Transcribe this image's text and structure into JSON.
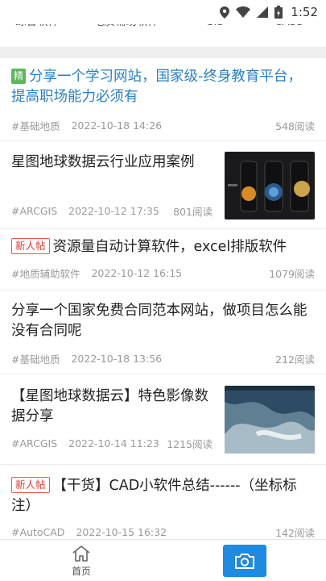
{
  "status_bar": {
    "time": "1:52",
    "icons": [
      "location-icon",
      "wifi-icon",
      "signal-icon",
      "battery-icon"
    ]
  },
  "tabs": [
    {
      "label": "综合软件"
    },
    {
      "label": "地质辅助软件"
    },
    {
      "label": "GIS"
    },
    {
      "label": "CASS"
    }
  ],
  "feed": [
    {
      "badge": "精",
      "title": "分享一个学习网站，国家级-终身教育平台，提高职场能力必须有",
      "tag": "#基础地质",
      "date": "2022-10-18 14:26",
      "reads": "548阅读"
    },
    {
      "title": "星图地球数据云行业应用案例",
      "tag": "#ARCGIS",
      "date": "2022-10-12 17:35",
      "reads": "801阅读"
    },
    {
      "badge": "新人帖",
      "title": "资源量自动计算软件，excel排版软件",
      "tag": "#地质辅助软件",
      "date": "2022-10-12 16:15",
      "reads": "1079阅读"
    },
    {
      "title": "分享一个国家免费合同范本网站，做项目怎么能没有合同呢",
      "tag": "#基础地质",
      "date": "2022-10-18 13:56",
      "reads": "212阅读"
    },
    {
      "title": "【星图地球数据云】特色影像数据分享",
      "tag": "#ARCGIS",
      "date": "2022-10-14 11:23",
      "reads": "1215阅读"
    },
    {
      "badge": "新人帖",
      "title": "【干货】CAD小软件总结------（坐标标注）",
      "tag": "#AutoCAD",
      "date": "2022-10-15 16:32",
      "reads": "142阅读"
    }
  ],
  "bottom_nav": {
    "home_label": "首页"
  },
  "colors": {
    "accent": "#1e8ae0",
    "title_blue": "#2a7fc4",
    "badge_green": "#5cb85c",
    "badge_red": "#e03a3a"
  }
}
